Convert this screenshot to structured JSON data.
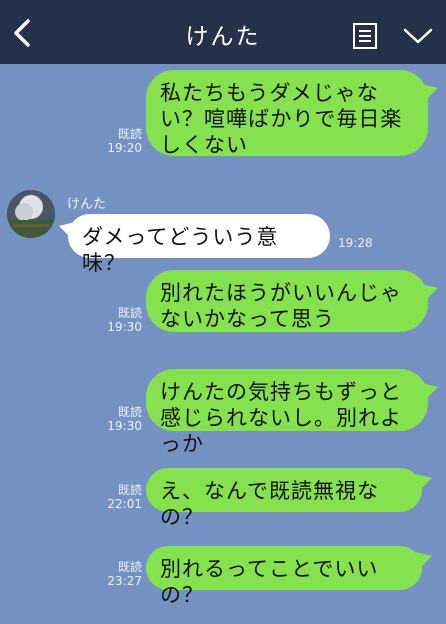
{
  "header": {
    "title": "けんた",
    "back_icon": "chevron-left-icon",
    "menu_icon": "document-list-icon",
    "dropdown_icon": "chevron-down-icon"
  },
  "messages": [
    {
      "side": "right",
      "text": "私たちもうダメじゃない？喧嘩ばかりで毎日楽しくない",
      "read": "既読",
      "time": "19:20"
    },
    {
      "side": "left",
      "sender": "けんた",
      "text": "ダメってどういう意味？",
      "time": "19:28"
    },
    {
      "side": "right",
      "text": "別れたほうがいいんじゃないかなって思う",
      "read": "既読",
      "time": "19:30"
    },
    {
      "side": "right",
      "text": "けんたの気持ちもずっと感じられないし。別れよっか",
      "read": "既読",
      "time": "19:30"
    },
    {
      "side": "right",
      "text": "え、なんで既読無視なの？",
      "read": "既読",
      "time": "22:01"
    },
    {
      "side": "right",
      "text": "別れるってことでいいの？",
      "read": "既読",
      "time": "23:27"
    }
  ],
  "colors": {
    "background": "#7392c2",
    "header": "#253049",
    "bubble_sent": "#86e14e",
    "bubble_received": "#ffffff"
  }
}
